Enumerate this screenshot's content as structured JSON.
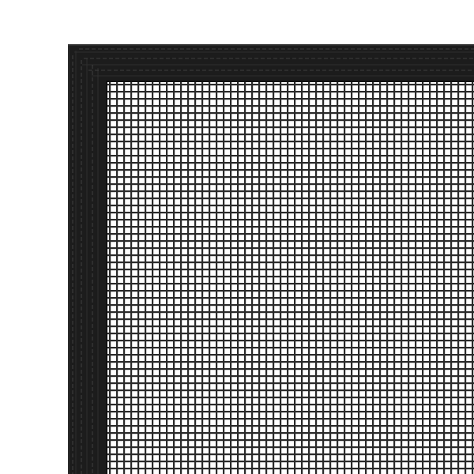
{
  "image": {
    "subject": "insect-screen-corner",
    "colors": {
      "background": "#ffffff",
      "frame": "#1c1c1c",
      "frame_highlight": "#2e2e2e",
      "stitch": "#4a4a4a",
      "mesh": "#2a2a2a"
    }
  }
}
